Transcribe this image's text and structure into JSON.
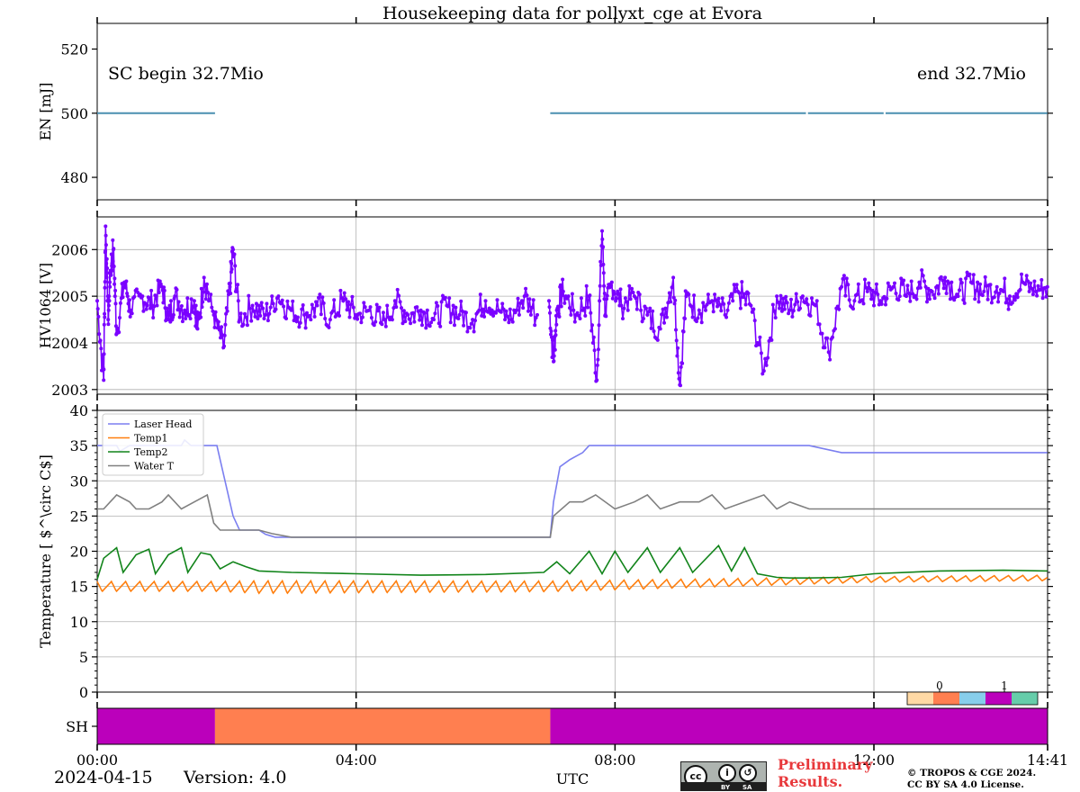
{
  "title": "Housekeeping data for pollyxt_cge at Evora",
  "colors": {
    "energy": "#4a8fb0",
    "hv": "#7a00ff",
    "laser_head": "#7b7ff0",
    "temp1": "#ff7f0e",
    "temp2": "#11841a",
    "water_t": "#808080",
    "sh_purple": "#bb00bb",
    "sh_orange": "#ff7f50",
    "cb": [
      "#ffd9a5",
      "#ff7f50",
      "#87ceeb",
      "#bb00bb",
      "#66cdaa"
    ]
  },
  "chart_data": [
    {
      "type": "line",
      "name": "energy",
      "ylabel": "EN [mJ]",
      "ylim": [
        473,
        528
      ],
      "yticks": [
        480,
        500,
        520
      ],
      "annotations": {
        "left": "SC begin 32.7Mio",
        "right": "end 32.7Mio"
      },
      "segments": [
        {
          "x": [
            0.0,
            1.82
          ],
          "y": [
            500,
            500
          ]
        },
        {
          "x": [
            7.0,
            10.95
          ],
          "y": [
            500,
            500
          ]
        },
        {
          "x": [
            10.98,
            12.15
          ],
          "y": [
            500,
            500
          ]
        },
        {
          "x": [
            12.18,
            14.68
          ],
          "y": [
            500,
            500
          ]
        }
      ]
    },
    {
      "type": "line",
      "name": "hv1064",
      "ylabel": "HV1064 [V]",
      "ylim": [
        2002.9,
        2006.7
      ],
      "yticks": [
        2003,
        2004,
        2005,
        2006
      ],
      "segments": [
        {
          "x": [
            0.0,
            0.1,
            0.13,
            0.17,
            0.2,
            0.25,
            0.3,
            0.42,
            0.52,
            0.7,
            0.85,
            1.0,
            1.1,
            1.2,
            1.35,
            1.5,
            1.55,
            1.65,
            1.8,
            1.95,
            2.05,
            2.1,
            2.2,
            2.4,
            2.6,
            2.8,
            3.0,
            3.2,
            3.4,
            3.6,
            3.8,
            4.0,
            4.2,
            4.4,
            4.6,
            4.8,
            5.0,
            5.2,
            5.4,
            5.6,
            5.8,
            6.0,
            6.2,
            6.4,
            6.6,
            6.8
          ],
          "y": [
            2004.9,
            2003.2,
            2006.5,
            2004.5,
            2005.5,
            2006.0,
            2004.2,
            2005.3,
            2004.7,
            2005.0,
            2004.8,
            2005.2,
            2004.5,
            2005.0,
            2004.7,
            2004.9,
            2004.3,
            2005.4,
            2004.6,
            2003.9,
            2005.2,
            2006.0,
            2004.5,
            2004.8,
            2004.6,
            2005.0,
            2004.7,
            2004.6,
            2004.8,
            2004.5,
            2004.9,
            2004.6,
            2004.7,
            2004.4,
            2004.9,
            2004.6,
            2004.7,
            2004.5,
            2004.8,
            2004.6,
            2004.5,
            2004.9,
            2004.7,
            2004.5,
            2005.0,
            2004.6
          ]
        },
        {
          "x": [
            6.98,
            7.05,
            7.1,
            7.2,
            7.4,
            7.6,
            7.72,
            7.8,
            7.85,
            7.95,
            8.1,
            8.3,
            8.5,
            8.7,
            8.9,
            9.0,
            9.1,
            9.3,
            9.5,
            9.7,
            9.9,
            10.1,
            10.3,
            10.5,
            10.7,
            10.9,
            11.1,
            11.3,
            11.5,
            11.7,
            11.9,
            12.1,
            12.3,
            12.5,
            12.7,
            12.9,
            13.1,
            13.3,
            13.5,
            13.7,
            13.9,
            14.1,
            14.3,
            14.5,
            14.68
          ],
          "y": [
            2004.9,
            2003.6,
            2004.7,
            2005.1,
            2004.6,
            2005.0,
            2003.2,
            2006.4,
            2004.6,
            2005.3,
            2004.8,
            2005.0,
            2004.6,
            2004.3,
            2005.4,
            2003.1,
            2005.0,
            2004.7,
            2004.9,
            2004.6,
            2005.1,
            2004.8,
            2003.4,
            2005.0,
            2004.7,
            2005.0,
            2004.8,
            2003.8,
            2005.2,
            2004.9,
            2005.1,
            2004.9,
            2005.2,
            2005.0,
            2005.3,
            2005.1,
            2005.4,
            2005.0,
            2005.3,
            2005.1,
            2005.2,
            2005.0,
            2005.3,
            2005.1,
            2005.2
          ]
        }
      ]
    },
    {
      "type": "line",
      "name": "temperature",
      "ylabel": "Temperature [ $^\\circ C$]",
      "ylim": [
        0,
        40
      ],
      "yticks": [
        0,
        5,
        10,
        15,
        20,
        25,
        30,
        35,
        40
      ],
      "series": [
        {
          "name": "Laser Head",
          "color_key": "laser_head",
          "x": [
            0.0,
            0.3,
            0.35,
            0.5,
            0.55,
            1.3,
            1.35,
            1.45,
            1.5,
            1.85,
            1.9,
            2.0,
            2.1,
            2.2,
            2.5,
            2.6,
            2.75,
            3.0,
            4.0,
            5.0,
            6.0,
            7.0,
            7.05,
            7.15,
            7.3,
            7.5,
            7.6,
            7.7,
            7.8,
            8.0,
            8.5,
            9.0,
            10.0,
            10.5,
            11.0,
            11.5,
            12.0,
            13.0,
            13.9,
            14.68
          ],
          "y": [
            35,
            35,
            34.2,
            35,
            35,
            35,
            35.8,
            35,
            35,
            35,
            33,
            29,
            25,
            23,
            23,
            22.4,
            22,
            22,
            22,
            22,
            22,
            22,
            27,
            32,
            33,
            34,
            35,
            35,
            35,
            35,
            35,
            35,
            35,
            35,
            35,
            34,
            34,
            34,
            34,
            34
          ]
        },
        {
          "name": "Temp1",
          "color_key": "temp1",
          "kind": "osc",
          "x": [
            0.0,
            1.8,
            2.5,
            7.0,
            10.0,
            12.0,
            14.68
          ],
          "y": [
            15.0,
            15.0,
            14.9,
            15.0,
            15.6,
            16.0,
            16.2
          ],
          "amp": [
            1.4,
            1.4,
            1.8,
            1.5,
            1.1,
            0.8,
            0.8
          ],
          "period": 0.22
        },
        {
          "name": "Temp2",
          "color_key": "temp2",
          "x": [
            0.0,
            0.1,
            0.3,
            0.4,
            0.6,
            0.8,
            0.9,
            1.1,
            1.3,
            1.4,
            1.6,
            1.75,
            1.9,
            2.1,
            2.3,
            2.5,
            3.0,
            4.0,
            5.0,
            6.0,
            6.9,
            7.1,
            7.3,
            7.6,
            7.8,
            8.0,
            8.2,
            8.5,
            8.7,
            9.0,
            9.2,
            9.6,
            9.8,
            10.0,
            10.2,
            10.5,
            10.7,
            11.0,
            11.5,
            12.0,
            13.0,
            14.0,
            14.68
          ],
          "y": [
            16,
            19,
            20.5,
            17,
            19.5,
            20.3,
            16.8,
            19.5,
            20.5,
            17,
            19.8,
            19.5,
            17.5,
            18.5,
            17.8,
            17.2,
            17,
            16.8,
            16.6,
            16.7,
            17,
            18.5,
            16.8,
            20,
            16.8,
            20,
            17,
            20.5,
            17,
            20.5,
            17,
            20.8,
            17.2,
            20.5,
            16.8,
            16.3,
            16.2,
            16.2,
            16.3,
            16.8,
            17.2,
            17.3,
            17.2
          ]
        },
        {
          "name": "Water T",
          "color_key": "water_t",
          "x": [
            0.0,
            0.1,
            0.2,
            0.3,
            0.5,
            0.6,
            0.8,
            1.0,
            1.1,
            1.3,
            1.5,
            1.7,
            1.8,
            1.9,
            2.0,
            2.2,
            2.5,
            2.7,
            3.0,
            4.0,
            5.0,
            6.0,
            7.0,
            7.05,
            7.3,
            7.5,
            7.7,
            8.0,
            8.3,
            8.5,
            8.7,
            9.0,
            9.3,
            9.5,
            9.7,
            10.0,
            10.3,
            10.5,
            10.7,
            11.0,
            11.5,
            12.0,
            13.0,
            14.0,
            14.68
          ],
          "y": [
            26,
            26,
            27,
            28,
            27,
            26,
            26,
            27,
            28,
            26,
            27,
            28,
            24,
            23,
            23,
            23,
            23,
            22.5,
            22,
            22,
            22,
            22,
            22,
            25,
            27,
            27,
            28,
            26,
            27,
            28,
            26,
            27,
            27,
            28,
            26,
            27,
            28,
            26,
            27,
            26,
            26,
            26,
            26,
            26,
            26
          ]
        }
      ],
      "legend": {
        "placement": "upper-left",
        "entries": [
          "Laser Head",
          "Temp1",
          "Temp2",
          "Water T"
        ]
      },
      "colorbar_ticks": [
        "0",
        "1"
      ]
    },
    {
      "type": "bar",
      "name": "shutter",
      "ylabel": "SH",
      "segments": [
        {
          "from": 0.0,
          "to": 1.82,
          "color_key": "sh_purple"
        },
        {
          "from": 1.82,
          "to": 7.0,
          "color_key": "sh_orange"
        },
        {
          "from": 7.0,
          "to": 14.68,
          "color_key": "sh_purple"
        }
      ]
    }
  ],
  "xaxis": {
    "xlabel": "UTC",
    "range": [
      0,
      14.6833
    ],
    "ticks": [
      0,
      4,
      8,
      12,
      14.6833
    ],
    "tick_labels": [
      "00:00",
      "04:00",
      "08:00",
      "12:00",
      "14:41"
    ]
  },
  "footer": {
    "date": "2024-04-15",
    "version": "Version: 4.0",
    "preliminary_line1": "Preliminary",
    "preliminary_line2": "Results.",
    "copyright_line1": "© TROPOS & CGE 2024.",
    "copyright_line2": "CC BY SA 4.0 License.",
    "cc_by": "BY",
    "cc_sa": "SA"
  }
}
